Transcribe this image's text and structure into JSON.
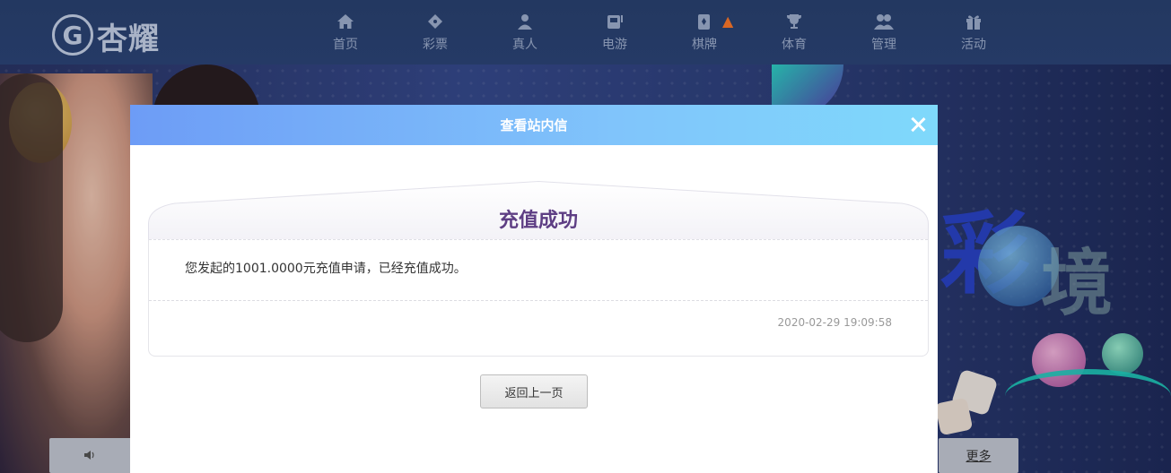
{
  "brand": {
    "logo_text": "杏耀",
    "emblem": "G"
  },
  "nav": {
    "items": [
      {
        "label": "首页",
        "icon": "home-icon"
      },
      {
        "label": "彩票",
        "icon": "ticket-icon"
      },
      {
        "label": "真人",
        "icon": "dealer-icon"
      },
      {
        "label": "电游",
        "icon": "arcade-icon"
      },
      {
        "label": "棋牌",
        "icon": "cards-icon",
        "badge": "hot-flame-icon"
      },
      {
        "label": "体育",
        "icon": "trophy-icon"
      },
      {
        "label": "管理",
        "icon": "users-icon"
      },
      {
        "label": "活动",
        "icon": "gift-icon"
      }
    ]
  },
  "bottom": {
    "more_label": "更多",
    "speaker_icon": "speaker-icon"
  },
  "modal": {
    "title": "查看站内信",
    "message": {
      "heading": "充值成功",
      "content": "您发起的1001.0000元充值申请，已经充值成功。",
      "timestamp": "2020-02-29 19:09:58"
    },
    "back_label": "返回上一页"
  },
  "colors": {
    "topbar": "#2a4272",
    "nav_text": "#9fb0cf",
    "modal_header_start": "#6d9cf6",
    "modal_header_end": "#7fd9fb",
    "heading": "#5e3e84"
  }
}
